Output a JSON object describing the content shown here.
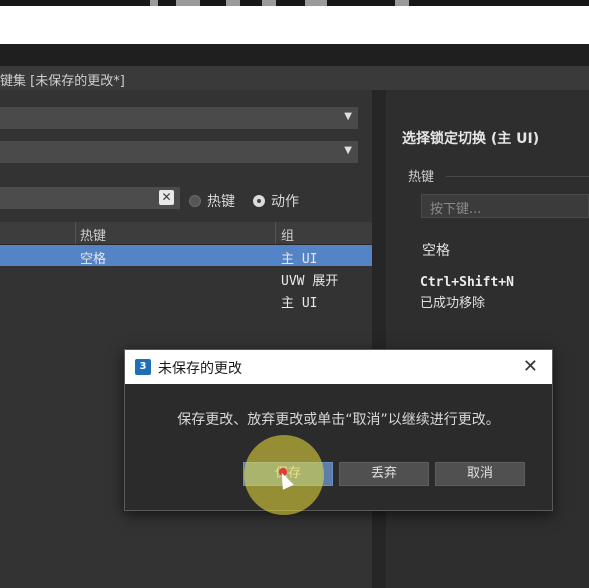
{
  "window": {
    "title": "键集 [未保存的更改*]"
  },
  "left": {
    "radios": [
      {
        "label": "热键",
        "selected": false
      },
      {
        "label": "动作",
        "selected": true
      }
    ],
    "table": {
      "headers": [
        "热键",
        "组"
      ],
      "rows": [
        {
          "hotkey": "空格",
          "group": "主 UI",
          "selected": true
        },
        {
          "hotkey": "",
          "group": "UVW 展开",
          "selected": false
        },
        {
          "hotkey": "",
          "group": "主 UI",
          "selected": false
        }
      ]
    }
  },
  "right": {
    "title": "选择锁定切换 (主 UI)",
    "hotkey_label": "热键",
    "input_placeholder": "按下键...",
    "current_key": "空格",
    "message_line1": "Ctrl+Shift+N",
    "message_line2": "已成功移除"
  },
  "dialog": {
    "icon_text": "3",
    "title": "未保存的更改",
    "close": "✕",
    "message": "保存更改、放弃更改或单击“取消”以继续进行更改。",
    "buttons": {
      "save": "保存",
      "discard": "丢弃",
      "cancel": "取消"
    }
  },
  "colors": {
    "selection": "#5483c6",
    "highlight": "#ece03c"
  }
}
